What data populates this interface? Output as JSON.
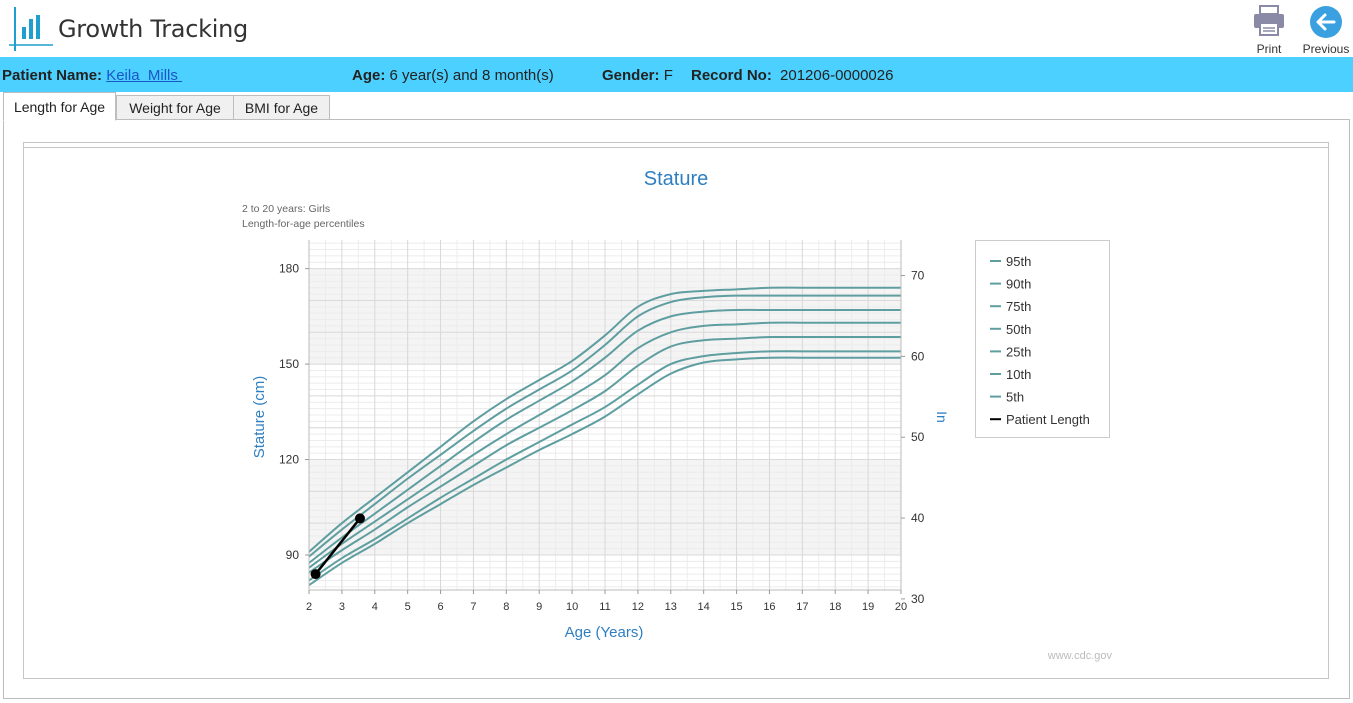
{
  "app": {
    "title": "Growth Tracking"
  },
  "toolbar": {
    "print_label": "Print",
    "previous_label": "Previous"
  },
  "patient": {
    "name_label": "Patient Name:",
    "name": "Keila  Mills ",
    "age_label": "Age:",
    "age": "6 year(s) and 8 month(s)",
    "gender_label": "Gender:",
    "gender": "F",
    "record_label": "Record No:",
    "record": "201206-0000026"
  },
  "tabs": [
    {
      "label": "Length for Age",
      "active": true
    },
    {
      "label": "Weight for Age",
      "active": false
    },
    {
      "label": "BMI for Age",
      "active": false
    }
  ],
  "colors": {
    "accent": "#4cd0ff",
    "chart_title": "#2e7fc1",
    "percentile_line": "#5f9ea0",
    "patient_line": "#000000"
  },
  "chart_data": {
    "type": "line",
    "title": "Stature",
    "subtitle_lines": [
      "2 to 20 years: Girls",
      "Length-for-age percentiles"
    ],
    "xlabel": "Age (Years)",
    "ylabel": "Stature (cm)",
    "y2label": "In",
    "xlim": [
      2,
      20
    ],
    "ylim": [
      79,
      189
    ],
    "y2lim": [
      31.1,
      74.4
    ],
    "x_ticks": [
      2,
      3,
      4,
      5,
      6,
      7,
      8,
      9,
      10,
      11,
      12,
      13,
      14,
      15,
      16,
      17,
      18,
      19,
      20
    ],
    "y_ticks": [
      90,
      120,
      150,
      180
    ],
    "y2_ticks": [
      30,
      40,
      50,
      60,
      70
    ],
    "grid": true,
    "legend_position": "right",
    "watermark": "www.cdc.gov",
    "x": [
      2,
      3,
      4,
      5,
      6,
      7,
      8,
      9,
      10,
      11,
      12,
      13,
      14,
      15,
      16,
      17,
      18,
      19,
      20
    ],
    "series": [
      {
        "name": "95th",
        "values": [
          91,
          100,
          108,
          116,
          124,
          132,
          139,
          145,
          151,
          159,
          168,
          172,
          173,
          173.5,
          174,
          174,
          174,
          174,
          174
        ]
      },
      {
        "name": "90th",
        "values": [
          89.5,
          98,
          106,
          114,
          121.5,
          129,
          136,
          142,
          148,
          156,
          165,
          169.5,
          171,
          171.5,
          171.5,
          171.5,
          171.5,
          171.5,
          171.5
        ]
      },
      {
        "name": "75th",
        "values": [
          87.5,
          95.5,
          103,
          110.5,
          118,
          125.5,
          132.5,
          138.5,
          144.5,
          152,
          160.5,
          165,
          166.5,
          167,
          167,
          167,
          167,
          167,
          167
        ]
      },
      {
        "name": "50th",
        "values": [
          86,
          93.5,
          100.5,
          107.5,
          114.5,
          121.5,
          128,
          134,
          140,
          146.5,
          155,
          160,
          162,
          162.5,
          163,
          163,
          163,
          163,
          163
        ]
      },
      {
        "name": "25th",
        "values": [
          84.5,
          91.5,
          98,
          105,
          111.5,
          118,
          124.5,
          130,
          135.5,
          141.5,
          149.5,
          155.5,
          157.5,
          158,
          158.5,
          158.5,
          158.5,
          158.5,
          158.5
        ]
      },
      {
        "name": "10th",
        "values": [
          82,
          89,
          95,
          101.5,
          108,
          114,
          120,
          125.5,
          131,
          136.5,
          143.5,
          150,
          152.5,
          153.5,
          154,
          154,
          154,
          154,
          154
        ]
      },
      {
        "name": "5th",
        "values": [
          80.5,
          87.5,
          93.5,
          100,
          106,
          112,
          117.5,
          123,
          128,
          133.5,
          140.5,
          147,
          150.5,
          151.5,
          152,
          152,
          152,
          152,
          152
        ]
      }
    ],
    "patient_series": {
      "name": "Patient Length",
      "x": [
        2.2,
        3.55
      ],
      "values": [
        84,
        101.5
      ]
    }
  }
}
